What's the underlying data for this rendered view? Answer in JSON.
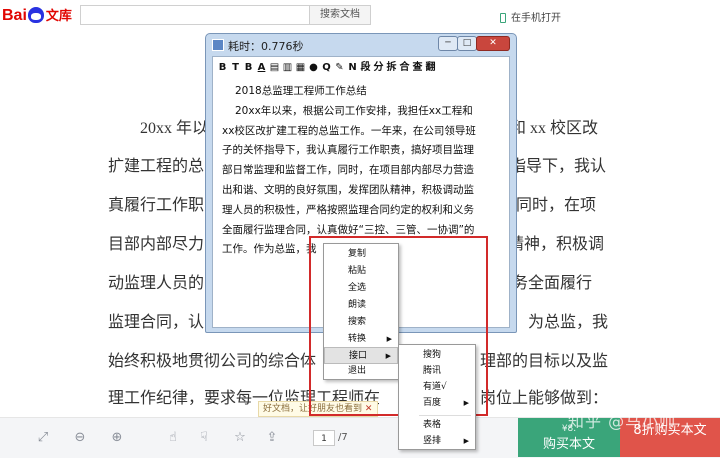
{
  "header": {
    "logo_bai": "Bai",
    "logo_du": "du",
    "logo_wenku": "文库",
    "search_placeholder": "",
    "search_button": "搜索文档",
    "open_on_phone": "在手机打开"
  },
  "document": {
    "lines": [
      "20xx 年以",
      "扩建工程的总",
      "真履行工作职",
      "目部内部尽力",
      "动监理人员的",
      "监理合同，认",
      "始终积极地贯彻公司的综合体",
      "理工作纪律，要求每一位监理工程师在"
    ],
    "right_lines": [
      "和 xx 校区改",
      "指导下，我认",
      "同时，在项",
      "精神，积极调",
      "义务全面履行",
      "为总监，我",
      "理部的目标以及监",
      "岗位上能够做到："
    ]
  },
  "window": {
    "title": "耗时：0.776秒",
    "min_btn": "─",
    "max_btn": "□",
    "close_btn": "✕",
    "toolbar": [
      "B",
      "T",
      "B",
      "A",
      "▤",
      "▥",
      "▦",
      "●",
      "Q",
      "✎",
      "N",
      "段",
      "分",
      "拆",
      "合",
      "查",
      "翻"
    ],
    "text_lines": [
      "2018总监理工程师工作总结",
      "20xx年以来，根据公司工作安排，我担任xx工程和",
      "xx校区改扩建工程的总监工作。一年来，在公司领导班",
      "子的关怀指导下，我认真履行工作职责，搞好项目监理",
      "部日常监理和监督工作，同时，在项目部内部尽力营造",
      "出和谐、文明的良好氛围，发挥团队精神，积极调动监",
      "理人员的积极性，严格按照监理合同约定的权利和义务",
      "全面履行监理合同，认真做好“三控、三管、一协调”的",
      "工作。作为总监，我"
    ]
  },
  "context_menu": {
    "items": [
      "复制",
      "粘贴",
      "全选",
      "朗读",
      "搜索",
      "转换",
      "接口",
      "退出"
    ]
  },
  "submenu": {
    "items": [
      "搜狗",
      "腾讯",
      "有道√",
      "百度",
      "表格",
      "竖排"
    ]
  },
  "bottombar": {
    "page_current": "1",
    "page_total": "/7",
    "share_tip": "好文档，让好朋友也看到",
    "share_tip_close": "✕",
    "buy_price": "¥8.",
    "buy_label": "购买本文",
    "discount_price": "",
    "discount_label": "8折购买本文",
    "watermark": "知乎 @马小帅"
  },
  "colors": {
    "brand_red": "#e10602",
    "brand_blue": "#2932e1",
    "buy_green": "#3aa57a",
    "buy_red": "#e0544a",
    "highlight_red": "#d22a2a"
  }
}
